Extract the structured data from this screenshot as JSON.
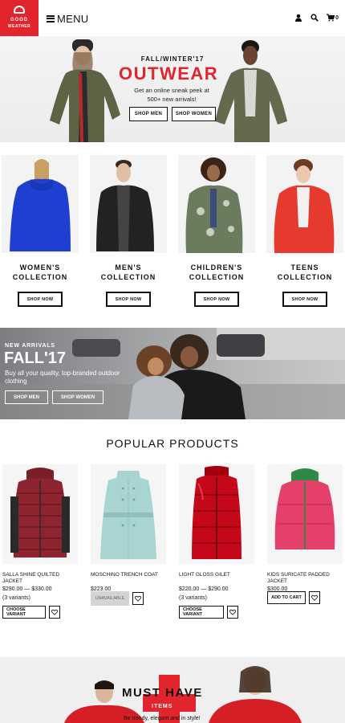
{
  "brand": {
    "name_line1": "GOOD",
    "name_line2": "WEATHER",
    "color": "#e2242d"
  },
  "header": {
    "menu_label": "MENU",
    "icons": [
      "user-icon",
      "search-icon",
      "cart-icon"
    ],
    "cart_count": "0"
  },
  "hero": {
    "kicker": "FALL/WINTER'17",
    "headline": "OUTWEAR",
    "subtitle": "Get an online sneak peek at 500+ new arrivals!",
    "buttons": [
      "SHOP MEN",
      "SHOP WOMEN"
    ]
  },
  "collections": [
    {
      "line1": "WOMEN'S",
      "line2": "COLLECTION",
      "button": "SHOP NOW"
    },
    {
      "line1": "MEN'S",
      "line2": "COLLECTION",
      "button": "SHOP NOW"
    },
    {
      "line1": "CHILDREN'S",
      "line2": "COLLECTION",
      "button": "SHOP NOW"
    },
    {
      "line1": "TEENS",
      "line2": "COLLECTION",
      "button": "SHOP NOW"
    }
  ],
  "arrivals": {
    "kicker": "NEW ARRIVALS",
    "headline": "FALL'17",
    "subtitle": "Buy all your quality, top-branded outdoor clothing",
    "buttons": [
      "SHOP MEN",
      "SHOP WOMEN"
    ]
  },
  "popular": {
    "title": "POPULAR PRODUCTS",
    "products": [
      {
        "name": "SALLA SHINE QUILTED JACKET",
        "price": "$290.00 — $330.00",
        "variants": "(3 variants)",
        "action": "CHOOSE VARIANT",
        "unavailable": false
      },
      {
        "name": "MOSCHINO TRENCH COAT",
        "price": "$223.00",
        "variants": "",
        "action": "UNAVAILABLE",
        "unavailable": true
      },
      {
        "name": "LIGHT GLOSS GILET",
        "price": "$220.00 — $290.00",
        "variants": "(3 variants)",
        "action": "CHOOSE VARIANT",
        "unavailable": false
      },
      {
        "name": "KIDS SURICATE PADDED JACKET",
        "price": "$300.00",
        "variants": "",
        "action": "ADD TO CART",
        "unavailable": false
      }
    ]
  },
  "musthave": {
    "headline": "MUST HAVE",
    "items_label": "ITEMS",
    "tagline": "Be trendy, elegant and in style!"
  }
}
